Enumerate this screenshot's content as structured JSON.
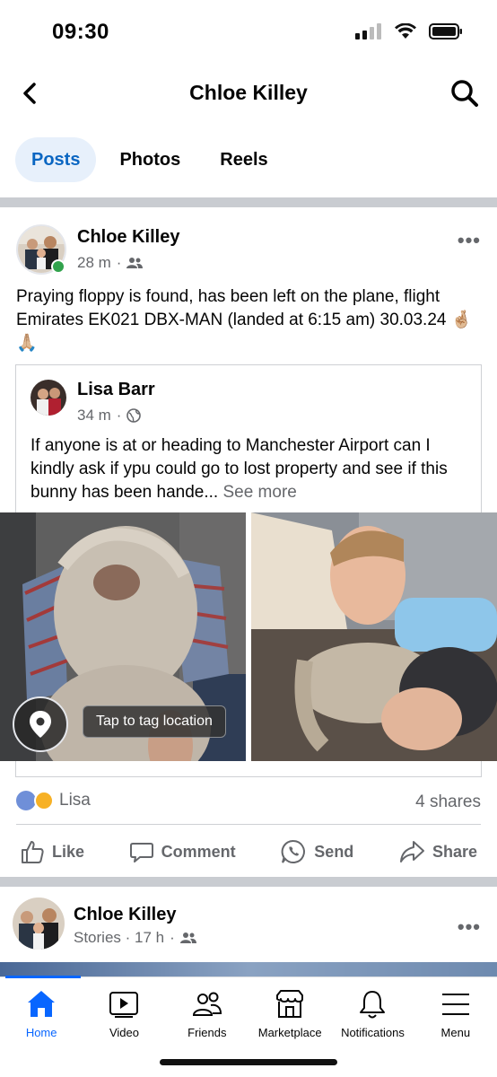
{
  "status_bar": {
    "time": "09:30"
  },
  "header": {
    "title": "Chloe Killey"
  },
  "tabs": [
    {
      "label": "Posts",
      "active": true
    },
    {
      "label": "Photos",
      "active": false
    },
    {
      "label": "Reels",
      "active": false
    }
  ],
  "post": {
    "author": "Chloe Killey",
    "time": "28 m",
    "text": "Praying floppy is found, has been left on the plane, flight Emirates EK021 DBX-MAN (landed at 6:15 am) 30.03.24 🤞🏼🙏🏼",
    "shared": {
      "author": "Lisa Barr",
      "time": "34 m",
      "text": "If anyone is at or heading to Manchester Airport can I kindly ask if ypu could go to lost property and see if this bunny has been hande...",
      "see_more": "See more"
    },
    "location_tip": "Tap to tag location",
    "reaction_name": "Lisa",
    "shares": "4 shares",
    "actions": {
      "like": "Like",
      "comment": "Comment",
      "send": "Send",
      "share": "Share"
    }
  },
  "post2": {
    "author": "Chloe Killey",
    "meta": "Stories · 17 h"
  },
  "bottom_nav": [
    {
      "label": "Home",
      "icon": "home-icon",
      "active": true
    },
    {
      "label": "Video",
      "icon": "video-icon",
      "active": false
    },
    {
      "label": "Friends",
      "icon": "friends-icon",
      "active": false
    },
    {
      "label": "Marketplace",
      "icon": "marketplace-icon",
      "active": false
    },
    {
      "label": "Notifications",
      "icon": "bell-icon",
      "active": false
    },
    {
      "label": "Menu",
      "icon": "menu-icon",
      "active": false
    }
  ],
  "colors": {
    "accent": "#0866ff",
    "tab_active_bg": "#e7f0fb",
    "online": "#31a24c"
  }
}
